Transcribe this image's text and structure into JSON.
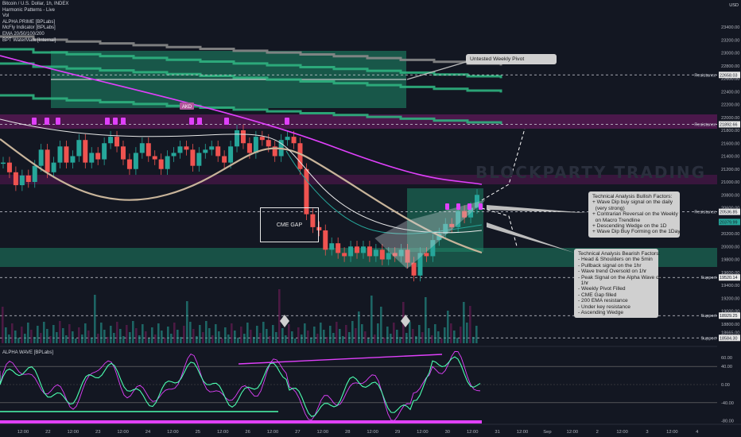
{
  "legend": {
    "lines": [
      "Bitcoin / U.S. Dollar, 1h, INDEX",
      "Harmonic Patterns - Live",
      "Vol",
      "ALPHA PRIME [BPLabs]",
      "McFly Indicator [BPLabs]",
      "EMA 20/50/100/200",
      "BPT WaterMark [Internal]"
    ]
  },
  "currency": "USD",
  "watermark": "BLOCKPARTY TRADING",
  "notes": {
    "pivot": "Untested Weekly Pivot",
    "bullish": "Technical Analysis Bullish Factors:\n+ Wave Dip buy signal on the daily\n  (very strong)\n+ Contrarian Reversal on the Weekly\n  on Macro Trendline\n+ Descending Wedge on the 1D\n+ Wave Dip Buy Forming on the 1Day",
    "bearish": "Technical Analysis Bearish Factors:\n- Head & Shoulders on the 5min\n- Pullback signal on the 1hr\n- Wave trend Oversold on 1hr\n- Peak Signal on the Alpha Wave on\n  1hr\n- Weekly Pivot Filled\n- CME Gap filled\n- 200 EMA resistance\n- Under key resistance\n- Ascending Wedge"
  },
  "cme_label": "CME GAP",
  "akd_label": "AKD",
  "oscillator_title": "ALPHA WAVE [BPLabs]",
  "price_axis": {
    "ticks": [
      "23400.00",
      "23200.00",
      "23000.00",
      "22800.00",
      "22600.00",
      "22400.00",
      "22200.00",
      "22000.00",
      "21800.00",
      "21600.00",
      "21400.00",
      "21200.00",
      "21000.00",
      "20800.00",
      "20600.00",
      "20400.00",
      "20200.00",
      "20000.00",
      "19800.00",
      "19600.00",
      "19400.00",
      "19200.00",
      "19000.00",
      "18800.00",
      "18665.00",
      "18600.00"
    ],
    "tags": [
      {
        "value": "22658.03",
        "label": "Resistance"
      },
      {
        "value": "21892.66",
        "label": "Resistance"
      },
      {
        "value": "20536.85",
        "label": "Resistance"
      },
      {
        "value": "20379.99",
        "label": ""
      },
      {
        "value": "19520.14",
        "label": "Support"
      },
      {
        "value": "18929.25",
        "label": "Support"
      },
      {
        "value": "18584.30",
        "label": "Support"
      }
    ]
  },
  "osc_axis": {
    "ticks": [
      "60.00",
      "40.00",
      "0.00",
      "-40.00",
      "-80.00"
    ]
  },
  "time_axis": {
    "labels": [
      "12:00",
      "22",
      "12:00",
      "23",
      "12:00",
      "24",
      "12:00",
      "25",
      "12:00",
      "26",
      "12:00",
      "27",
      "12:00",
      "28",
      "12:00",
      "29",
      "12:00",
      "30",
      "12:00",
      "31",
      "12:00",
      "Sep",
      "12:00",
      "2",
      "12:00",
      "3",
      "12:00",
      "4"
    ]
  },
  "chart_data": {
    "type": "line",
    "title": "Bitcoin / U.S. Dollar, 1h, INDEX",
    "xlabel": "",
    "ylabel": "USD",
    "ylim": [
      18500,
      23500
    ],
    "series": [
      {
        "name": "",
        "values": [
          21300,
          21150,
          20950,
          21100,
          21000,
          21250,
          21500,
          21150,
          21300,
          21550,
          21300,
          21400,
          21650,
          21300,
          21450,
          21350,
          21600,
          21700,
          21550,
          21350,
          21200,
          21450,
          21600,
          21400,
          21350,
          21200,
          21400,
          21450,
          21550,
          21500,
          21250,
          21450,
          21500,
          21550,
          21400,
          21300,
          21550,
          21800,
          21600,
          21450,
          21700,
          21650,
          21550,
          21400,
          21650,
          21700,
          21600,
          21200,
          20500,
          20300,
          20250,
          19950,
          20050,
          19900,
          19850,
          20000,
          19900,
          20000,
          19850,
          19950,
          19800,
          19900,
          19850,
          19950,
          19750,
          19550,
          19900,
          19850,
          20100,
          20200,
          20350,
          20300,
          20550,
          20450,
          20600,
          20800
        ]
      }
    ],
    "levels": [
      {
        "price": 22658.03,
        "label": "Resistance"
      },
      {
        "price": 21892.66,
        "label": "Resistance"
      },
      {
        "price": 20536.85,
        "label": "Resistance"
      },
      {
        "price": 19520.14,
        "label": "Support"
      },
      {
        "price": 18929.25,
        "label": "Support"
      },
      {
        "price": 18584.3,
        "label": "Support"
      }
    ],
    "colors": {
      "bull": "#26a69a",
      "bear": "#ef5350",
      "magenta": "#e040fb",
      "pivot": "#1e8c6a",
      "ema200": "#c8b49a",
      "wave": "#4cffb0"
    }
  }
}
